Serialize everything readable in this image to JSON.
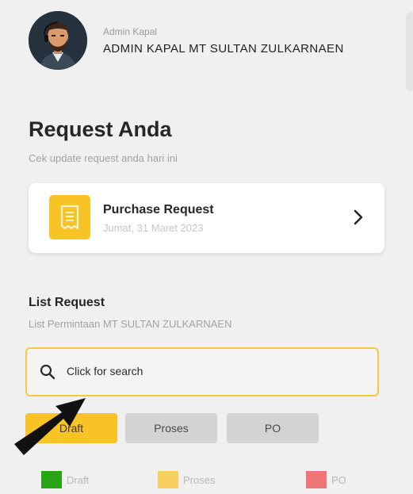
{
  "header": {
    "role": "Admin Kapal",
    "name": "ADMIN KAPAL MT SULTAN ZULKARNAEN"
  },
  "page": {
    "title": "Request Anda",
    "subtitle": "Cek update request anda hari ini"
  },
  "card": {
    "title": "Purchase Request",
    "date": "Jumat, 31 Maret 2023",
    "icon": "receipt-icon"
  },
  "list": {
    "title": "List Request",
    "subtitle": "List Permintaan MT SULTAN ZULKARNAEN"
  },
  "search": {
    "placeholder": "Click for search"
  },
  "tabs": [
    {
      "label": "Draft",
      "active": true
    },
    {
      "label": "Proses",
      "active": false
    },
    {
      "label": "PO",
      "active": false
    }
  ],
  "legend": [
    {
      "label": "Draft",
      "color": "#2aa318"
    },
    {
      "label": "Proses",
      "color": "#f7d060"
    },
    {
      "label": "PO",
      "color": "#f07575"
    }
  ],
  "colors": {
    "accent": "#f7c325",
    "inactive_tab": "#d3d3d3"
  }
}
